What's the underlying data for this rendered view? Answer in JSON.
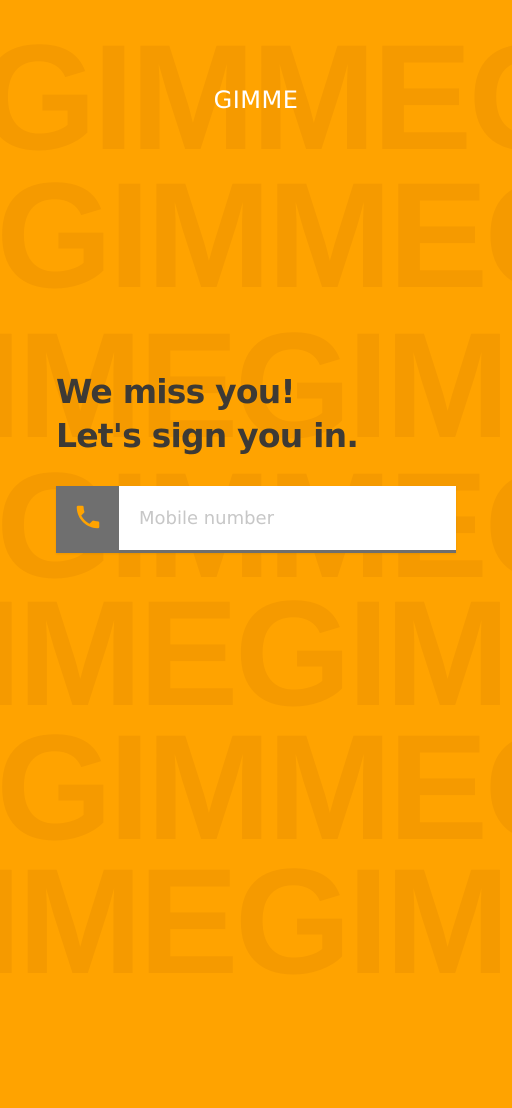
{
  "app": {
    "brand": "GIMME"
  },
  "background": {
    "rows": [
      "GIMMEGIMME",
      "GIMMEGIMME",
      "IMEGIMMEG",
      "GIMMEGIMME",
      "IMEGIMMEG",
      "GIMMEGIMME",
      "IMEGIMMEG"
    ],
    "color": "#F59A00",
    "base_color": "#FFA300"
  },
  "headline": {
    "line1": "We miss you!",
    "line2": "Let's sign you in."
  },
  "login": {
    "icon": "phone-icon",
    "placeholder": "Mobile number",
    "value": ""
  },
  "colors": {
    "accent": "#FFA300",
    "icon_box": "#6F6F6F",
    "text_dark": "#3D3A35"
  }
}
